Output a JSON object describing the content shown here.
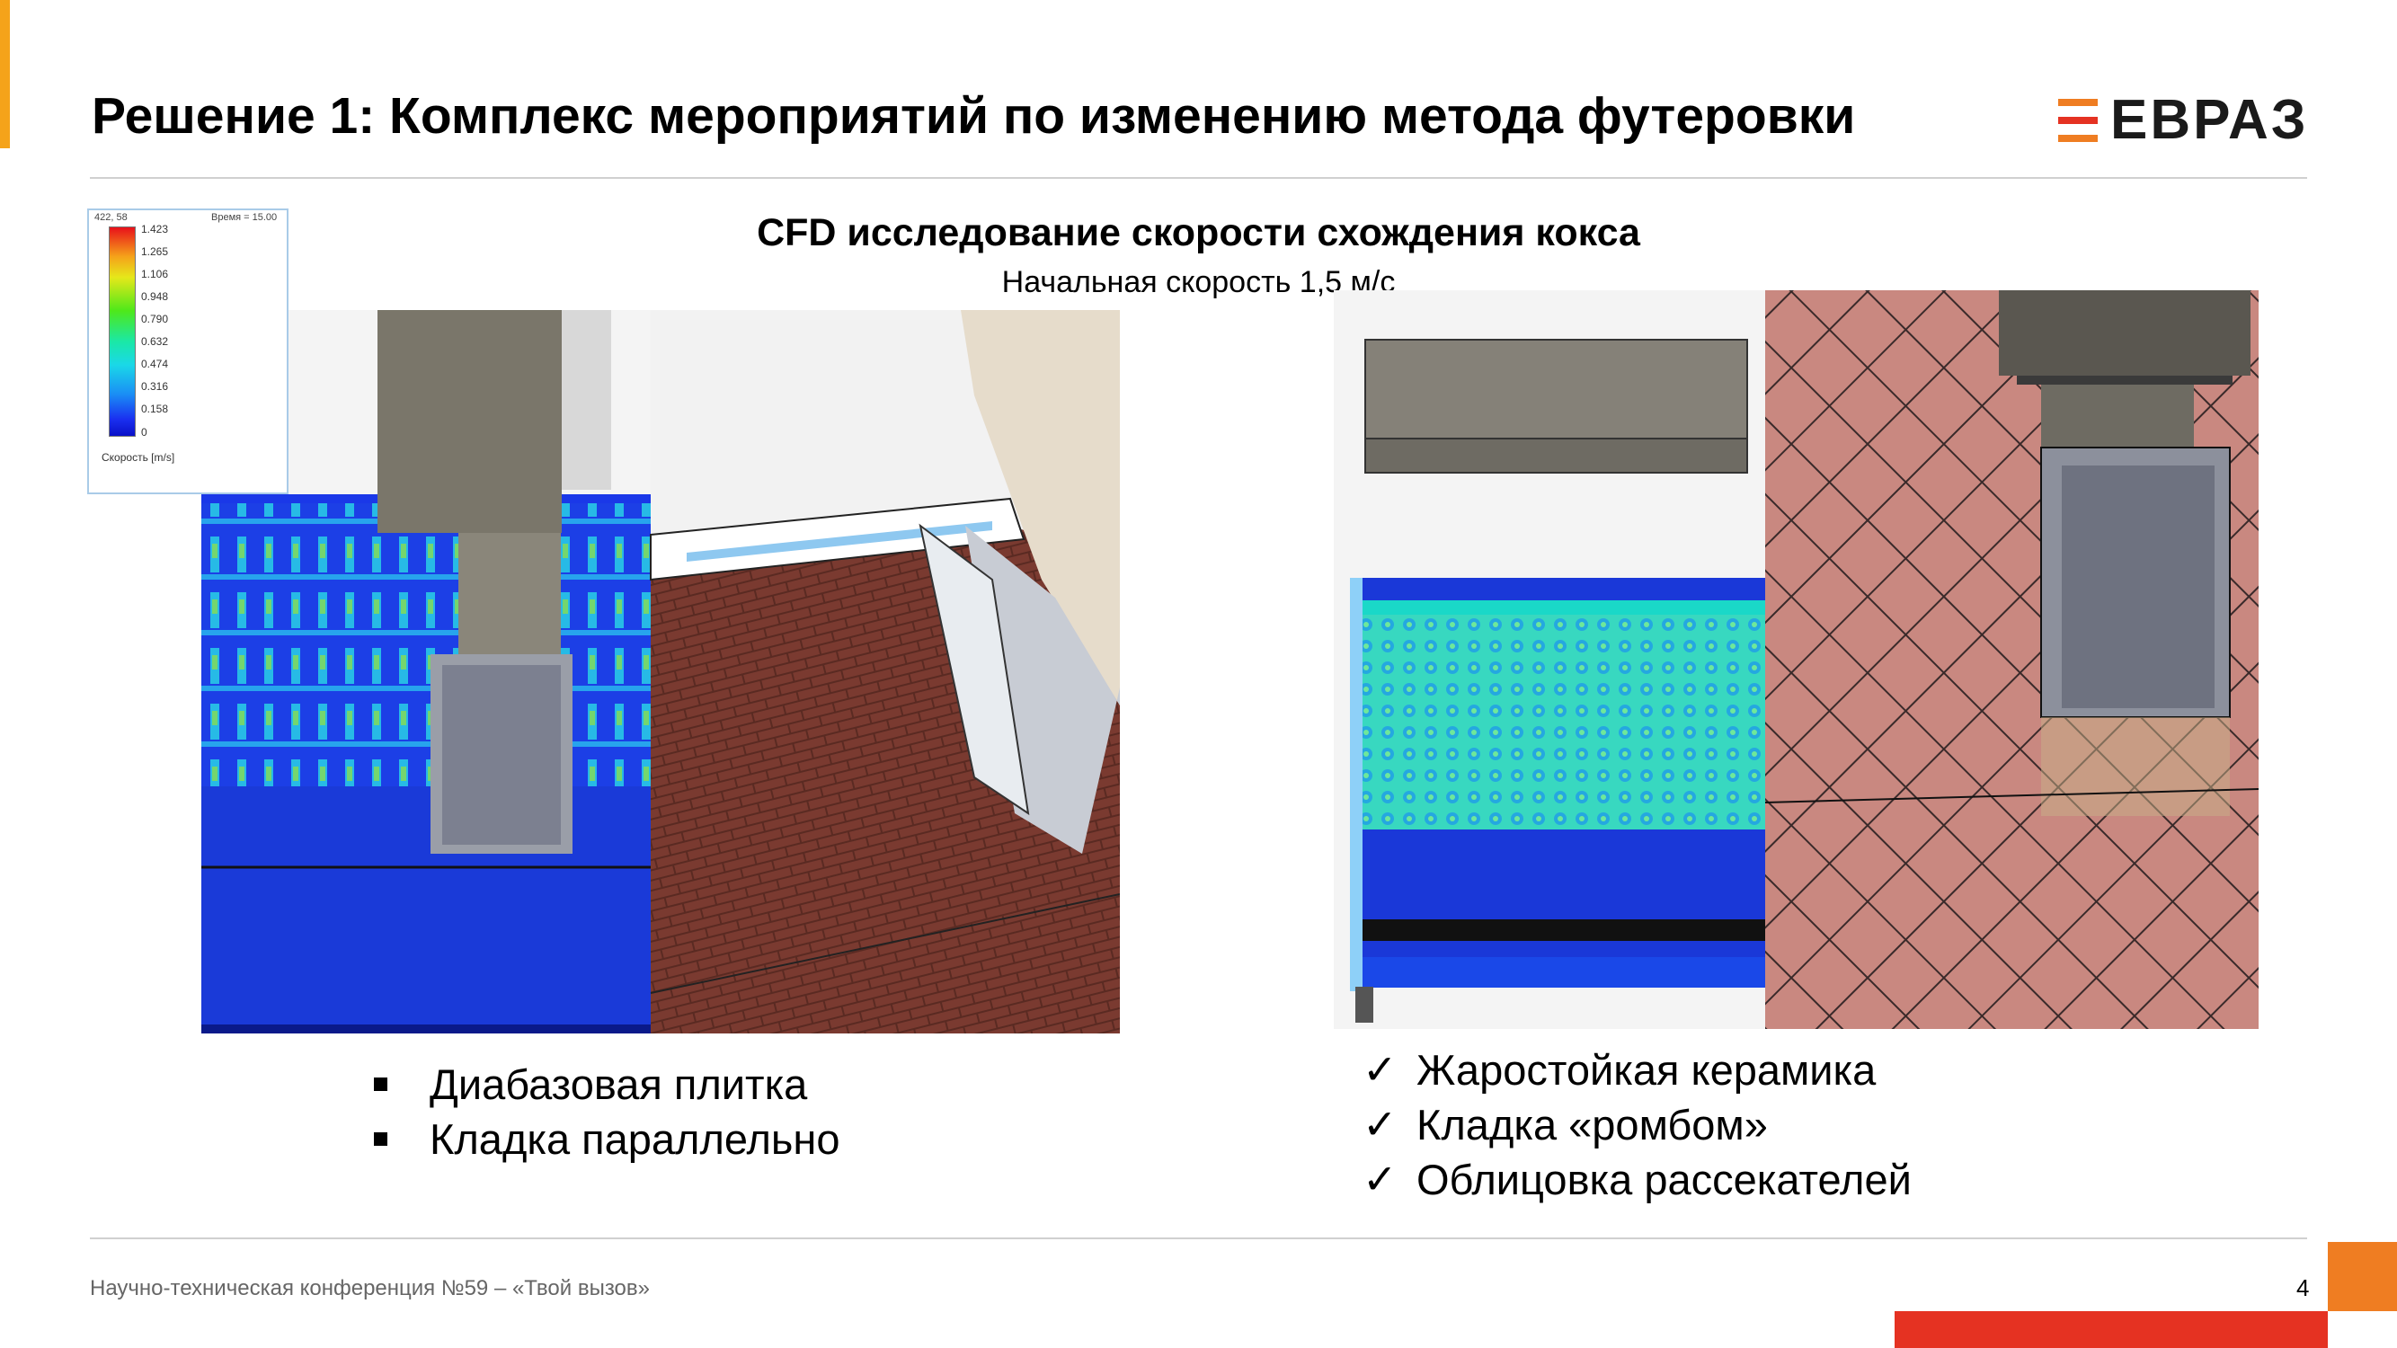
{
  "slide": {
    "title": "Решение 1: Комплекс мероприятий по изменению метода футеровки",
    "logo": {
      "text": "ЕВРАЗ",
      "bar_colors": [
        "#ef7d22",
        "#e53222",
        "#ef7d22"
      ]
    },
    "subtitle": "CFD исследование скорости схождения кокса",
    "subtitle2": "Начальная скорость 1,5 м/с",
    "page_number": "4",
    "footer": "Научно-техническая конференция №59 – «Твой вызов»"
  },
  "legend": {
    "head": "422, 58",
    "time": "Время = 15.00",
    "values": [
      "1.423",
      "1.265",
      "1.106",
      "0.948",
      "0.790",
      "0.632",
      "0.474",
      "0.316",
      "0.158",
      "0"
    ],
    "units": "Скорость [m/s]"
  },
  "left_list": {
    "bullet": "square",
    "items": [
      "Диабазовая плитка",
      "Кладка параллельно"
    ]
  },
  "right_list": {
    "bullet": "✓",
    "items": [
      "Жаростойкая керамика",
      "Кладка «ромбом»",
      "Облицовка рассекателей"
    ]
  },
  "colors": {
    "accent_orange": "#ef7d22",
    "accent_red": "#e53222",
    "accent_yellow": "#f5a31a"
  }
}
